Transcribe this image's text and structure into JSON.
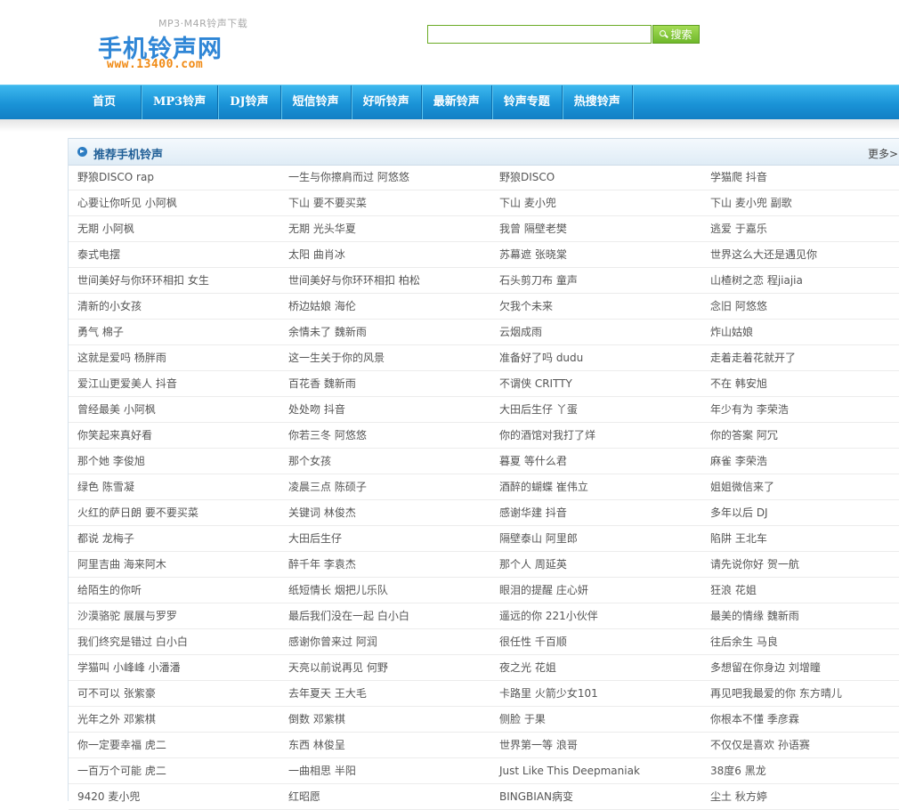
{
  "header": {
    "logo_tagline": "MP3·M4R铃声下载",
    "logo_text": "手机铃声网",
    "logo_url": "www.13400.com",
    "search": {
      "value": "",
      "placeholder": "",
      "button_label": "搜索",
      "button_icon": "search-icon"
    }
  },
  "nav": {
    "items": [
      "首页",
      "MP3铃声",
      "DJ铃声",
      "短信铃声",
      "好听铃声",
      "最新铃声",
      "铃声专题",
      "热搜铃声"
    ]
  },
  "panel": {
    "title": "推荐手机铃声",
    "title_icon": "arrow-circle-icon",
    "more": "更多>",
    "rows": [
      [
        "野狼DISCO rap",
        "一生与你擦肩而过 阿悠悠",
        "野狼DISCO",
        "学猫爬 抖音"
      ],
      [
        "心要让你听见 小阿枫",
        "下山 要不要买菜",
        "下山 麦小兜",
        "下山 麦小兜 副歌"
      ],
      [
        "无期 小阿枫",
        "无期 光头华夏",
        "我曾 隔壁老樊",
        "逃爱 于嘉乐"
      ],
      [
        "泰式电摆",
        "太阳 曲肖冰",
        "苏幕遮 张晓棠",
        "世界这么大还是遇见你"
      ],
      [
        "世间美好与你环环相扣 女生",
        "世间美好与你环环相扣 柏松",
        "石头剪刀布 童声",
        "山楂树之恋 程jiajia"
      ],
      [
        "清新的小女孩",
        "桥边姑娘 海伦",
        "欠我个未来",
        "念旧 阿悠悠"
      ],
      [
        "勇气 棉子",
        "余情未了 魏新雨",
        "云烟成雨",
        "炸山姑娘"
      ],
      [
        "这就是爱吗 杨胖雨",
        "这一生关于你的风景",
        "准备好了吗 dudu",
        "走着走着花就开了"
      ],
      [
        "爱江山更爱美人 抖音",
        "百花香 魏新雨",
        "不谓侠 CRITTY",
        "不在 韩安旭"
      ],
      [
        "曾经最美 小阿枫",
        "处处吻 抖音",
        "大田后生仔 丫蛋",
        "年少有为 李荣浩"
      ],
      [
        "你笑起来真好看",
        "你若三冬 阿悠悠",
        "你的酒馆对我打了烊",
        "你的答案 阿冗"
      ],
      [
        "那个她 李俊旭",
        "那个女孩",
        "暮夏 等什么君",
        "麻雀 李荣浩"
      ],
      [
        "绿色 陈雪凝",
        "凌晨三点 陈硕子",
        "酒醉的蝴蝶 崔伟立",
        "姐姐微信来了"
      ],
      [
        "火红的萨日朗 要不要买菜",
        "关键词 林俊杰",
        "感谢华建 抖音",
        "多年以后 DJ"
      ],
      [
        "都说 龙梅子",
        "大田后生仔",
        "隔壁泰山 阿里郎",
        "陷阱 王北车"
      ],
      [
        "阿里吉曲 海来阿木",
        "醉千年 李袁杰",
        "那个人 周延英",
        "请先说你好 贺一航"
      ],
      [
        "给陌生的你听",
        "纸短情长 烟把儿乐队",
        "眼泪的提醒 庄心妍",
        "狂浪 花姐"
      ],
      [
        "沙漠骆驼 展展与罗罗",
        "最后我们没在一起 白小白",
        "遥远的你 221小伙伴",
        "最美的情缘 魏新雨"
      ],
      [
        "我们终究是错过 白小白",
        "感谢你曾来过 阿润",
        "很任性 千百顺",
        "往后余生 马良"
      ],
      [
        "学猫叫 小峰峰 小潘潘",
        "天亮以前说再见 何野",
        "夜之光 花姐",
        "多想留在你身边 刘增瞳"
      ],
      [
        "可不可以 张紫豪",
        "去年夏天 王大毛",
        "卡路里 火箭少女101",
        "再见吧我最爱的你 东方晴儿"
      ],
      [
        "光年之外 邓紫棋",
        "倒数 邓紫棋",
        "侧脸 于果",
        "你根本不懂 季彦霖"
      ],
      [
        "你一定要幸福 虎二",
        "东西 林俊呈",
        "世界第一等 浪哥",
        "不仅仅是喜欢 孙语赛"
      ],
      [
        "一百万个可能 虎二",
        "一曲相思 半阳",
        "Just Like This Deepmaniak",
        "38度6 黑龙"
      ],
      [
        "9420 麦小兜",
        "红昭愿",
        "BINGBIAN病变",
        "尘土 秋方婷"
      ]
    ]
  }
}
